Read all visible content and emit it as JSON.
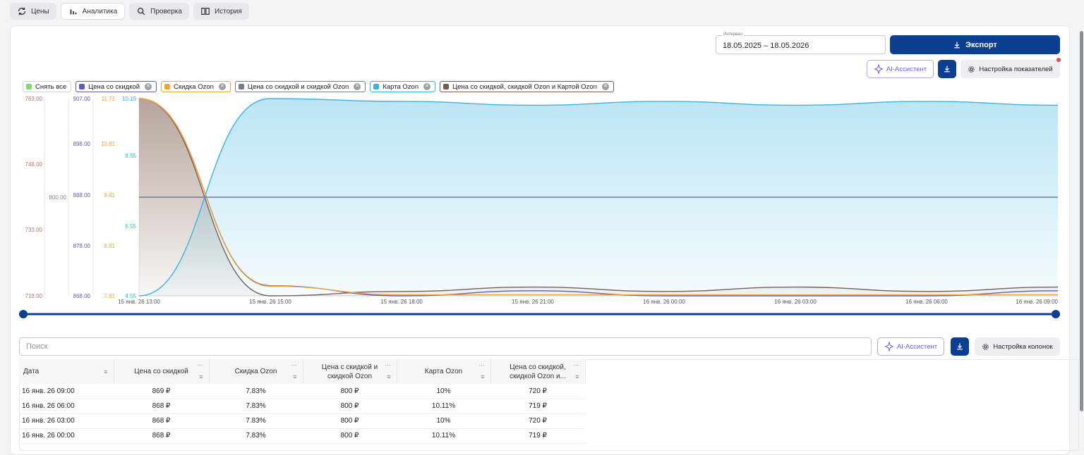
{
  "tabs": [
    {
      "label": "Цены",
      "icon": "refresh-price-icon",
      "active": false
    },
    {
      "label": "Аналитика",
      "icon": "bar-chart-icon",
      "active": true
    },
    {
      "label": "Проверка",
      "icon": "search-icon",
      "active": false
    },
    {
      "label": "История",
      "icon": "book-icon",
      "active": false
    }
  ],
  "toolbar": {
    "interval_label": "Интервал",
    "interval_value": "18.05.2025 – 18.05.2026",
    "export_label": "Экспорт",
    "ai_label": "AI-Ассистент",
    "settings_label": "Настройка показателей"
  },
  "legend": [
    {
      "label": "Снять все",
      "color": "#7fdc6b",
      "removable": false
    },
    {
      "label": "Цена со скидкой",
      "color": "#5b5fb8",
      "removable": true
    },
    {
      "label": "Скидка Ozon",
      "color": "#f3a33c",
      "removable": true
    },
    {
      "label": "Цена со скидкой и скидкой Ozon",
      "color": "#6f7f8c",
      "removable": true
    },
    {
      "label": "Карта Ozon",
      "color": "#3cb4e0",
      "removable": true
    },
    {
      "label": "Цена со скидкой, скидкой Ozon и Картой Ozon",
      "color": "#7a5a4a",
      "removable": true
    }
  ],
  "chart_data": {
    "type": "line",
    "x": [
      "15 янв. 26 13:00",
      "15 янв. 26 15:00",
      "15 янв. 26 18:00",
      "15 янв. 26 21:00",
      "16 янв. 26 00:00",
      "16 янв. 26 03:00",
      "16 янв. 26 06:00",
      "16 янв. 26 09:00"
    ],
    "axes": [
      {
        "id": "a1",
        "ticks": [
          "763.00",
          "748.00",
          "733.00",
          "718.00"
        ],
        "color": "#b07a6a"
      },
      {
        "id": "a2",
        "ticks": [
          "800.00"
        ],
        "color": "#7b8590"
      },
      {
        "id": "a3",
        "ticks": [
          "907.00",
          "898.00",
          "888.00",
          "878.00",
          "868.00"
        ],
        "color": "#5b5fb8"
      },
      {
        "id": "a4",
        "ticks": [
          "11.71",
          "10.81",
          "9.81",
          "8.81",
          "7.81"
        ],
        "color": "#f3a33c"
      },
      {
        "id": "a5",
        "ticks": [
          "10.19",
          "8.55",
          "6.55",
          "4.55"
        ],
        "color": "#3cb4e0"
      }
    ],
    "series": [
      {
        "name": "Цена со скидкой",
        "color": "#5b5fb8",
        "values": [
          907,
          870,
          868,
          869,
          868,
          868,
          868,
          869
        ]
      },
      {
        "name": "Скидка Ozon",
        "color": "#f3a33c",
        "values": [
          11.71,
          8.0,
          7.83,
          7.83,
          7.83,
          7.83,
          7.83,
          7.83
        ]
      },
      {
        "name": "Цена со скидкой и скидкой Ozon",
        "color": "#6f7f8c",
        "values": [
          800,
          800,
          800,
          800,
          800,
          800,
          800,
          800
        ]
      },
      {
        "name": "Карта Ozon",
        "color": "#3cb4e0",
        "values": [
          4.55,
          10.19,
          10.11,
          10.0,
          10.11,
          10.0,
          10.11,
          10.0
        ]
      },
      {
        "name": "Цена со скидкой, скидкой Ozon и Картой Ozon",
        "color": "#7a5a4a",
        "values": [
          763,
          718,
          719,
          720,
          719,
          720,
          719,
          720
        ]
      }
    ]
  },
  "table": {
    "search_placeholder": "Поиск",
    "ai_label": "AI-Ассистент",
    "settings_label": "Настройка колонок",
    "columns": [
      "Дата",
      "Цена со скидкой",
      "Скидка Ozon",
      "Цена с скидкой и скидкой Ozon",
      "Карта Ozon",
      "Цена со скидкой, скидкой Ozon и..."
    ],
    "rows": [
      [
        "16 янв. 26 09:00",
        "869 ₽",
        "7.83%",
        "800 ₽",
        "10%",
        "720 ₽"
      ],
      [
        "16 янв. 26 06:00",
        "868 ₽",
        "7.83%",
        "800 ₽",
        "10.11%",
        "719 ₽"
      ],
      [
        "16 янв. 26 03:00",
        "868 ₽",
        "7.83%",
        "800 ₽",
        "10%",
        "720 ₽"
      ],
      [
        "16 янв. 26 00:00",
        "868 ₽",
        "7.83%",
        "800 ₽",
        "10.11%",
        "719 ₽"
      ]
    ]
  }
}
